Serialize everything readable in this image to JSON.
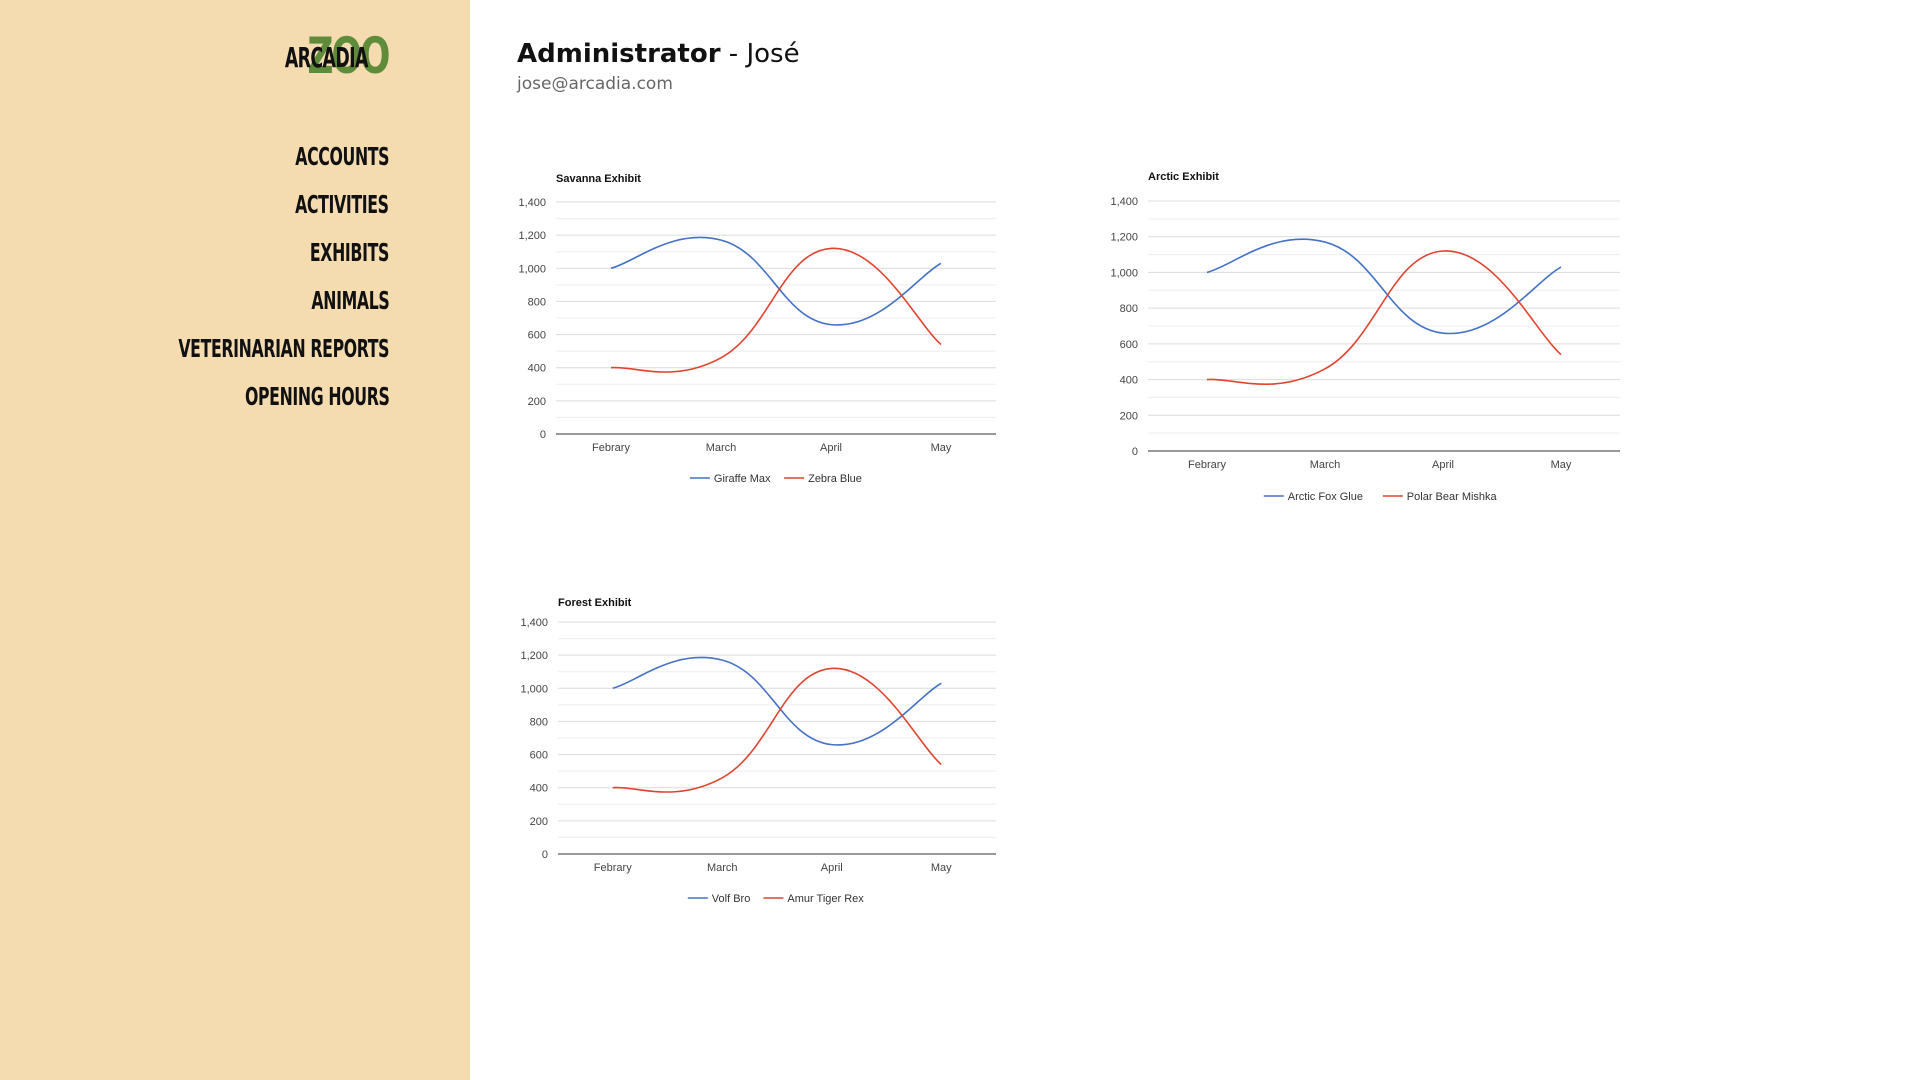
{
  "brand": {
    "arcadia": "ARCADIA",
    "zoo": "ZOO",
    "accent": "#5f8c3a",
    "sidebar_bg": "#f4dcb0"
  },
  "nav": {
    "items": [
      {
        "label": "ACCOUNTS"
      },
      {
        "label": "ACTIVITIES"
      },
      {
        "label": "EXHIBITS"
      },
      {
        "label": "ANIMALS"
      },
      {
        "label": "VETERINARIAN REPORTS"
      },
      {
        "label": "OPENING HOURS"
      }
    ]
  },
  "user": {
    "role": "Administrator",
    "separator": " - ",
    "name": "José",
    "email": "jose@arcadia.com"
  },
  "series_colors": [
    "#4472c4",
    "#e0442f"
  ],
  "chart_data": [
    {
      "type": "line",
      "title": "Savanna Exhibit",
      "categories": [
        "Febrary",
        "March",
        "April",
        "May"
      ],
      "ylim": [
        0,
        1400
      ],
      "yticks": [
        "0",
        "200",
        "400",
        "600",
        "800",
        "1,000",
        "1,200",
        "1,400"
      ],
      "grid": true,
      "legend": "bottom",
      "series": [
        {
          "name": "Giraffe Max",
          "values": [
            1000,
            1170,
            660,
            1030
          ]
        },
        {
          "name": "Zebra Blue",
          "values": [
            400,
            460,
            1120,
            540
          ]
        }
      ]
    },
    {
      "type": "line",
      "title": "Arctic Exhibit",
      "categories": [
        "Febrary",
        "March",
        "April",
        "May"
      ],
      "ylim": [
        0,
        1400
      ],
      "yticks": [
        "0",
        "200",
        "400",
        "600",
        "800",
        "1,000",
        "1,200",
        "1,400"
      ],
      "grid": true,
      "legend": "bottom",
      "series": [
        {
          "name": "Arctic Fox Glue",
          "values": [
            1000,
            1170,
            660,
            1030
          ]
        },
        {
          "name": "Polar Bear Mishka",
          "values": [
            400,
            460,
            1120,
            540
          ]
        }
      ]
    },
    {
      "type": "line",
      "title": "Forest Exhibit",
      "categories": [
        "Febrary",
        "March",
        "April",
        "May"
      ],
      "ylim": [
        0,
        1400
      ],
      "yticks": [
        "0",
        "200",
        "400",
        "600",
        "800",
        "1,000",
        "1,200",
        "1,400"
      ],
      "grid": true,
      "legend": "bottom",
      "series": [
        {
          "name": "Volf Bro",
          "values": [
            1000,
            1170,
            660,
            1030
          ]
        },
        {
          "name": "Amur Tiger Rex",
          "values": [
            400,
            460,
            1120,
            540
          ]
        }
      ]
    }
  ]
}
